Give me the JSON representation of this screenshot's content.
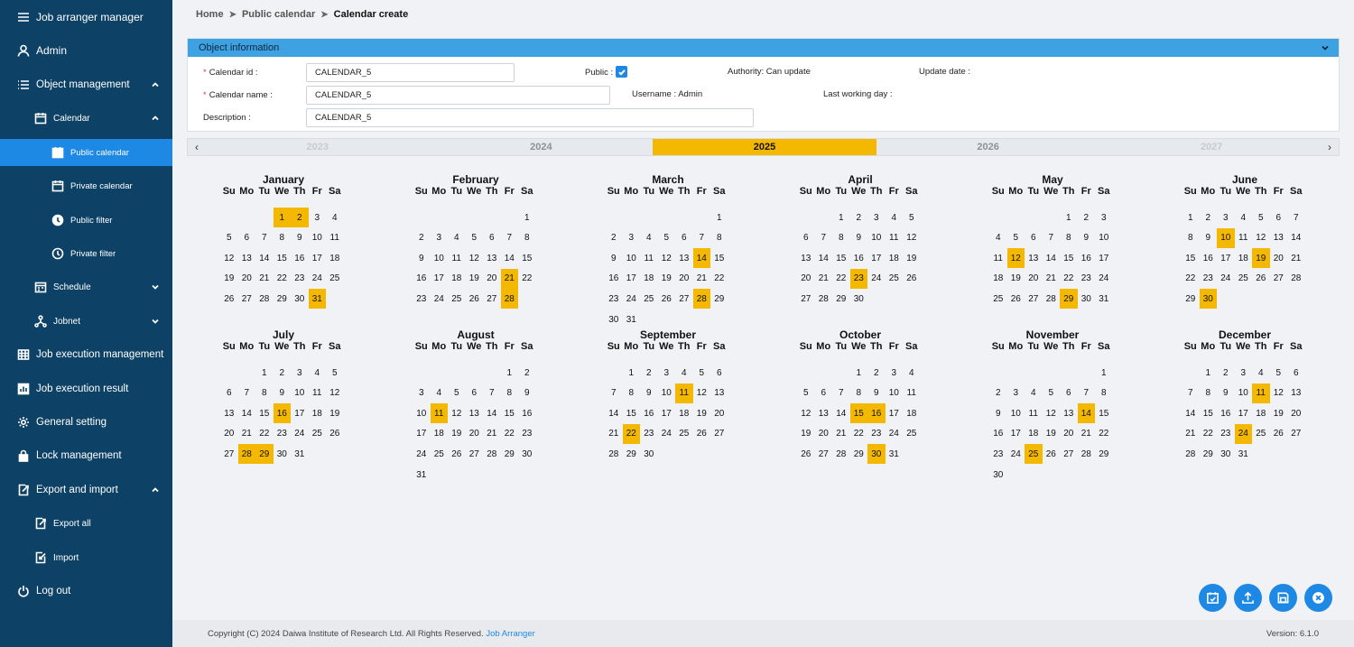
{
  "app": {
    "title": "Job arranger manager"
  },
  "sidebar": {
    "user": "Admin",
    "object_management": "Object management",
    "calendar": "Calendar",
    "public_calendar": "Public calendar",
    "private_calendar": "Private calendar",
    "public_filter": "Public filter",
    "private_filter": "Private filter",
    "schedule": "Schedule",
    "jobnet": "Jobnet",
    "job_execution_management": "Job execution management",
    "job_execution_result": "Job execution result",
    "general_setting": "General setting",
    "lock_management": "Lock management",
    "export_and_import": "Export and import",
    "export_all": "Export all",
    "import": "Import",
    "log_out": "Log out"
  },
  "breadcrumb": {
    "home": "Home",
    "public_calendar": "Public calendar",
    "current": "Calendar create"
  },
  "object_info": {
    "header": "Object information",
    "calendar_id_label": "Calendar id :",
    "calendar_id_value": "CALENDAR_5",
    "calendar_name_label": "Calendar name :",
    "calendar_name_value": "CALENDAR_5",
    "description_label": "Description :",
    "description_value": "CALENDAR_5",
    "public_label": "Public :",
    "public_checked": true,
    "authority": "Authority: Can update",
    "username": "Username : Admin",
    "update_date_label": "Update date :",
    "last_working_day_label": "Last working day :"
  },
  "years": {
    "prev": "‹",
    "next": "›",
    "items": [
      "2023",
      "2024",
      "2025",
      "2026",
      "2027"
    ],
    "selected": "2025"
  },
  "weekdays": [
    "Su",
    "Mo",
    "Tu",
    "We",
    "Th",
    "Fr",
    "Sa"
  ],
  "calendar": {
    "year": 2025,
    "months": [
      {
        "name": "January",
        "selected": [
          1,
          2,
          31
        ]
      },
      {
        "name": "February",
        "selected": [
          21,
          28
        ]
      },
      {
        "name": "March",
        "selected": [
          14,
          28
        ]
      },
      {
        "name": "April",
        "selected": [
          23
        ]
      },
      {
        "name": "May",
        "selected": [
          12,
          29
        ]
      },
      {
        "name": "June",
        "selected": [
          10,
          19,
          30
        ]
      },
      {
        "name": "July",
        "selected": [
          16,
          28,
          29
        ]
      },
      {
        "name": "August",
        "selected": [
          11
        ]
      },
      {
        "name": "September",
        "selected": [
          11,
          22
        ]
      },
      {
        "name": "October",
        "selected": [
          15,
          16,
          30
        ]
      },
      {
        "name": "November",
        "selected": [
          14,
          25
        ]
      },
      {
        "name": "December",
        "selected": [
          11,
          24
        ]
      }
    ]
  },
  "colors": {
    "sidebar_bg": "#0d4266",
    "accent": "#1e88e5",
    "highlight": "#f5b800",
    "header_bar": "#3da1e2"
  },
  "actions": [
    "calendar-check-icon",
    "upload-icon",
    "save-icon",
    "close-circle-icon"
  ],
  "footer": {
    "copyright": "Copyright (C) 2024 Daiwa Institute of Research Ltd. All Rights Reserved.",
    "link": "Job Arranger",
    "version": "Version: 6.1.0"
  }
}
